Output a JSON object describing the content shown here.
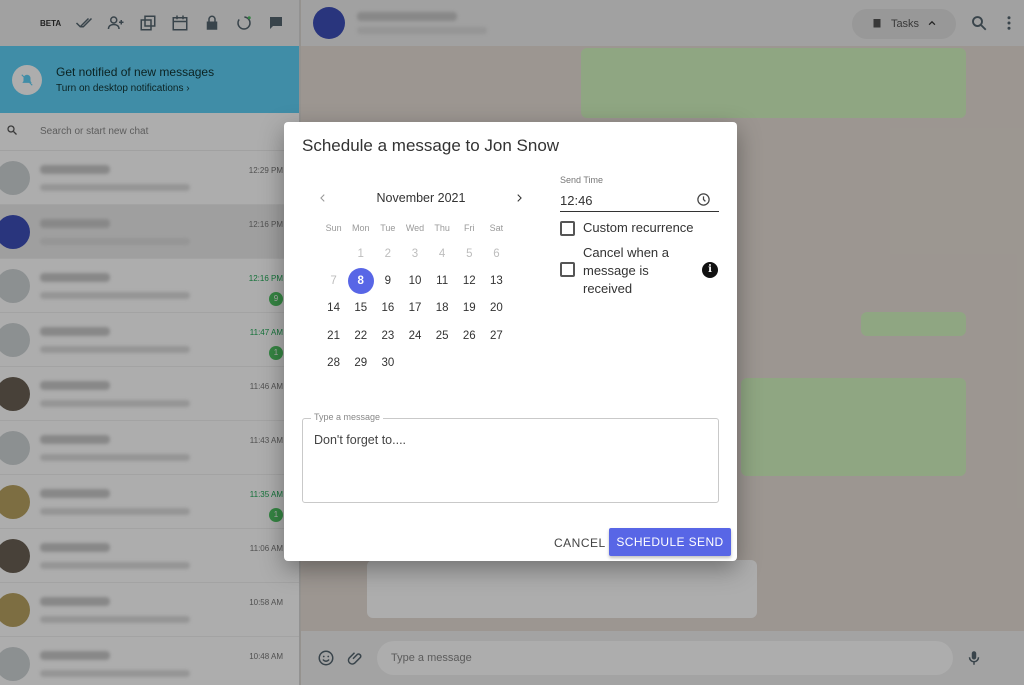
{
  "sidebar": {
    "beta_label": "BETA",
    "notification": {
      "title": "Get notified of new messages",
      "subtitle": "Turn on desktop notifications ›"
    },
    "search_placeholder": "Search or start new chat",
    "chats": [
      {
        "time": "12:29 PM",
        "selected": false,
        "unread": ""
      },
      {
        "time": "12:16 PM",
        "selected": true,
        "unread": ""
      },
      {
        "time": "12:16 PM",
        "selected": false,
        "unread": "9"
      },
      {
        "time": "11:47 AM",
        "selected": false,
        "unread": "1"
      },
      {
        "time": "11:46 AM",
        "selected": false,
        "unread": ""
      },
      {
        "time": "11:43 AM",
        "selected": false,
        "unread": ""
      },
      {
        "time": "11:35 AM",
        "selected": false,
        "unread": "1"
      },
      {
        "time": "11:06 AM",
        "selected": false,
        "unread": ""
      },
      {
        "time": "10:58 AM",
        "selected": false,
        "unread": ""
      },
      {
        "time": "10:48 AM",
        "selected": false,
        "unread": ""
      }
    ]
  },
  "conversation": {
    "tasks_label": "Tasks",
    "composer_placeholder": "Type a message"
  },
  "dialog": {
    "title": "Schedule a message to Jon Snow",
    "calendar": {
      "month_label": "November 2021",
      "weekdays": [
        "Sun",
        "Mon",
        "Tue",
        "Wed",
        "Thu",
        "Fri",
        "Sat"
      ],
      "weeks": [
        [
          null,
          "1",
          "2",
          "3",
          "4",
          "5",
          "6"
        ],
        [
          "7",
          "8",
          "9",
          "10",
          "11",
          "12",
          "13"
        ],
        [
          "14",
          "15",
          "16",
          "17",
          "18",
          "19",
          "20"
        ],
        [
          "21",
          "22",
          "23",
          "24",
          "25",
          "26",
          "27"
        ],
        [
          "28",
          "29",
          "30",
          null,
          null,
          null,
          null
        ]
      ],
      "selected_day": "8",
      "disabled_days": [
        "1",
        "2",
        "3",
        "4",
        "5",
        "6",
        "7"
      ]
    },
    "send_time": {
      "label": "Send Time",
      "value": "12:46"
    },
    "custom_recurrence_label": "Custom recurrence",
    "cancel_when_received_label": "Cancel when a message is received",
    "message": {
      "label": "Type a message",
      "value": "Don't forget to...."
    },
    "cancel_button": "CANCEL",
    "schedule_button": "SCHEDULE SEND",
    "colors": {
      "accent": "#5866e6"
    }
  }
}
